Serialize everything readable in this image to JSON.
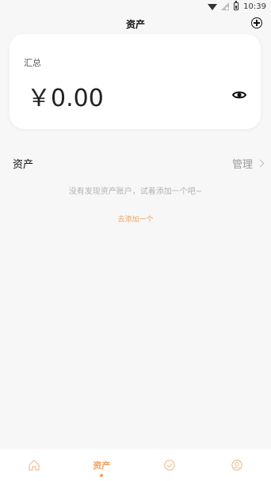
{
  "status_bar": {
    "time": "10:39"
  },
  "header": {
    "title": "资产"
  },
  "summary_card": {
    "label": "汇总",
    "amount": "￥0.00"
  },
  "assets_section": {
    "title": "资产",
    "manage_label": "管理",
    "empty_text": "没有发现资产账户，试着添加一个吧~",
    "add_link": "去添加一个"
  },
  "tabbar": {
    "tabs": [
      {
        "icon": "home-icon",
        "label": ""
      },
      {
        "icon": "wallet-icon",
        "label": "资产"
      },
      {
        "icon": "check-circle-icon",
        "label": ""
      },
      {
        "icon": "user-icon",
        "label": ""
      }
    ]
  },
  "colors": {
    "accent": "#f0a060",
    "background": "#f7f7f7",
    "card": "#ffffff"
  }
}
